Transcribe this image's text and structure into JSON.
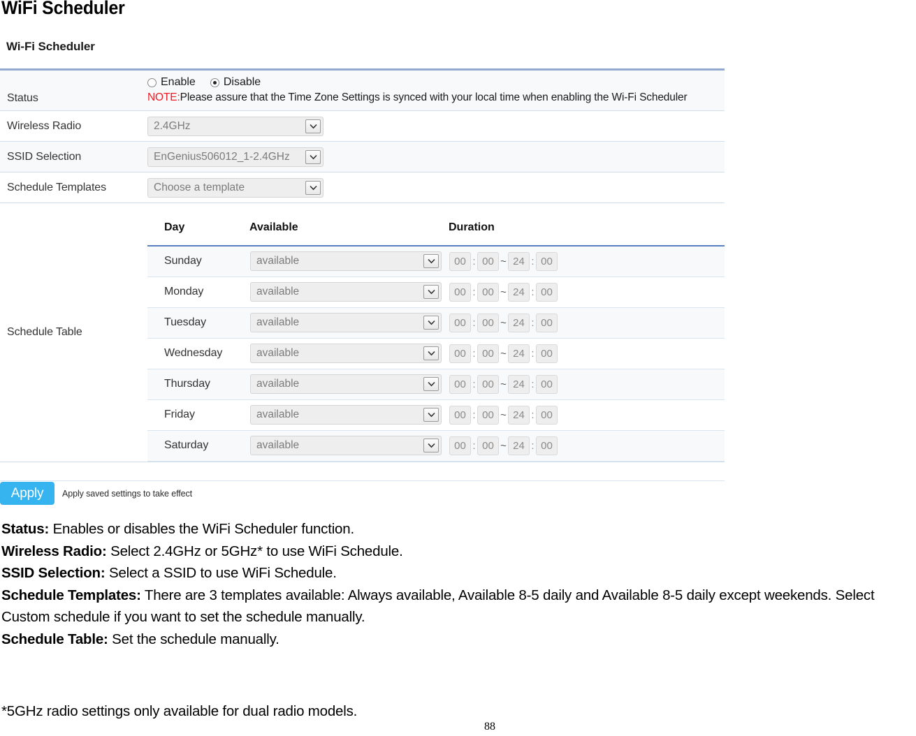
{
  "document": {
    "title": "WiFi Scheduler",
    "page_number": "88"
  },
  "panel": {
    "heading": "Wi-Fi Scheduler"
  },
  "form": {
    "status": {
      "label": "Status",
      "enable_label": "Enable",
      "disable_label": "Disable",
      "selected": "Disable",
      "note_prefix": "NOTE:",
      "note_text": "Please assure that the Time Zone Settings is synced with your local time when enabling the Wi-Fi Scheduler",
      "note_color": "#ee1c25"
    },
    "wireless_radio": {
      "label": "Wireless Radio",
      "value": "2.4GHz"
    },
    "ssid_selection": {
      "label": "SSID Selection",
      "value": "EnGenius506012_1-2.4GHz"
    },
    "schedule_templates": {
      "label": "Schedule Templates",
      "value": "Choose a template"
    },
    "schedule_table": {
      "label": "Schedule Table",
      "columns": [
        "Day",
        "Available",
        "Duration"
      ],
      "rows": [
        {
          "day": "Sunday",
          "available": "available",
          "start_hour": "00",
          "start_min": "00",
          "end_hour": "24",
          "end_min": "00"
        },
        {
          "day": "Monday",
          "available": "available",
          "start_hour": "00",
          "start_min": "00",
          "end_hour": "24",
          "end_min": "00"
        },
        {
          "day": "Tuesday",
          "available": "available",
          "start_hour": "00",
          "start_min": "00",
          "end_hour": "24",
          "end_min": "00"
        },
        {
          "day": "Wednesday",
          "available": "available",
          "start_hour": "00",
          "start_min": "00",
          "end_hour": "24",
          "end_min": "00"
        },
        {
          "day": "Thursday",
          "available": "available",
          "start_hour": "00",
          "start_min": "00",
          "end_hour": "24",
          "end_min": "00"
        },
        {
          "day": "Friday",
          "available": "available",
          "start_hour": "00",
          "start_min": "00",
          "end_hour": "24",
          "end_min": "00"
        },
        {
          "day": "Saturday",
          "available": "available",
          "start_hour": "00",
          "start_min": "00",
          "end_hour": "24",
          "end_min": "00"
        }
      ],
      "time_separator": ":",
      "range_separator": "~"
    }
  },
  "actions": {
    "apply_label": "Apply",
    "apply_hint": "Apply saved settings to take effect",
    "apply_color": "#35b4ef"
  },
  "descriptions": [
    {
      "term": "Status:",
      "text": " Enables or disables the WiFi Scheduler function."
    },
    {
      "term": "Wireless Radio:",
      "text": " Select 2.4GHz or 5GHz* to use WiFi Schedule."
    },
    {
      "term": "SSID Selection:",
      "text": " Select a SSID to use WiFi Schedule."
    },
    {
      "term": "Schedule Templates:",
      "text": " There are 3 templates available: Always available, Available 8-5 daily and Available 8-5 daily except weekends. Select Custom schedule if you want to set the schedule manually."
    },
    {
      "term": "Schedule Table:",
      "text": " Set the schedule manually."
    }
  ],
  "footnote": "*5GHz radio settings only available for dual radio models."
}
